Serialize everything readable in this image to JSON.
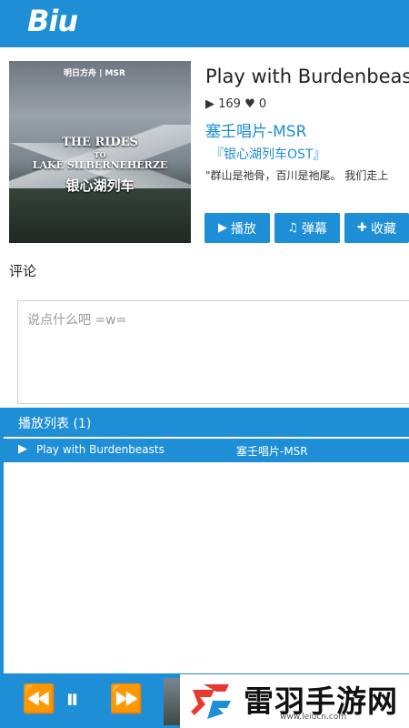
{
  "app": {
    "logo": "Biu"
  },
  "cover": {
    "brand_line": "明日方舟 | MSR",
    "title_a": "THE RIDES",
    "title_b": "TO",
    "title_c": "LAKE SILBERNEHERZE",
    "title_d": "银心湖列车"
  },
  "song": {
    "title": "Play with Burdenbeasts",
    "plays": "169",
    "likes": "0",
    "artist": "塞壬唱片-MSR",
    "album": "『银心湖列车OST』",
    "quote": "\"群山是祂骨，百川是祂尾。 我们走上"
  },
  "buttons": {
    "play": "播放",
    "danmu": "弹幕",
    "favorite": "收藏"
  },
  "comments": {
    "label": "评论",
    "placeholder": "说点什么吧 =w="
  },
  "playlist": {
    "title": "播放列表 (1)",
    "items": [
      {
        "name": "Play with Burdenbeasts",
        "artist": "塞壬唱片-MSR"
      }
    ]
  },
  "player": {
    "prev_icon": "previous-icon",
    "pause_icon": "pause-icon",
    "next_icon": "next-icon"
  },
  "watermark": {
    "text": "雷羽手游网",
    "url": "www.leiucn.com"
  },
  "colors": {
    "accent": "#1e8fd6"
  }
}
